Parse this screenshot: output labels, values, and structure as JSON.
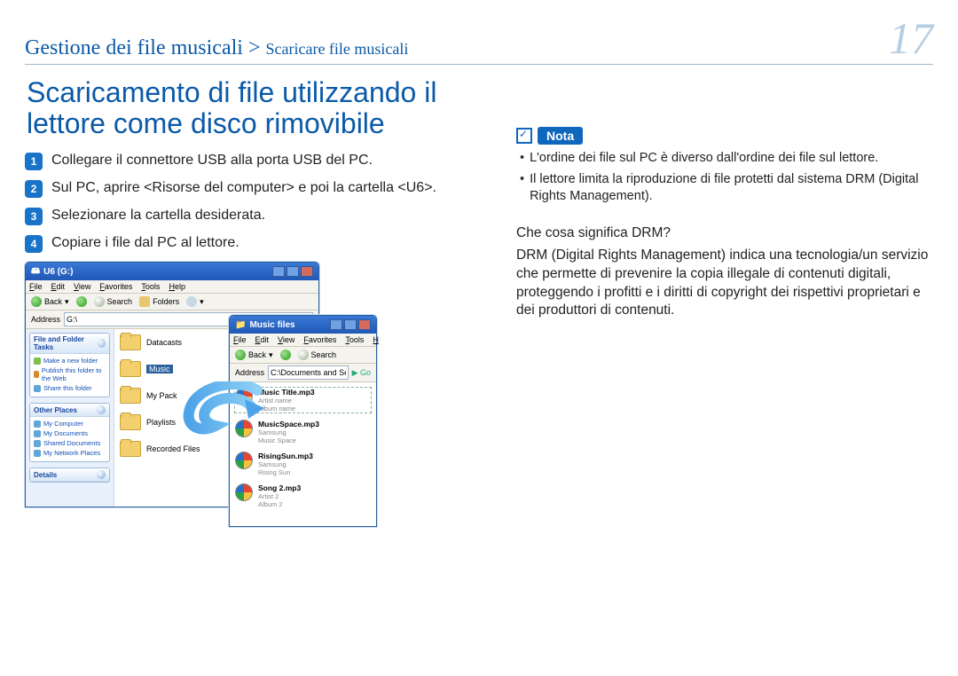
{
  "header": {
    "breadcrumb_main": "Gestione dei file musicali",
    "breadcrumb_separator": " > ",
    "breadcrumb_sub": "Scaricare file musicali",
    "page_number": "17"
  },
  "title": "Scaricamento di file utilizzando il lettore come disco rimovibile",
  "steps": {
    "s1": "Collegare il connettore USB alla porta USB del PC.",
    "s2": "Sul PC, aprire <Risorse del computer> e poi la cartella <U6>.",
    "s3": "Selezionare la cartella desiderata.",
    "s4": "Copiare i file dal PC al lettore."
  },
  "note": {
    "label": "Nota",
    "items": {
      "n1": "L'ordine dei file sul PC è diverso dall'ordine dei file sul lettore.",
      "n2": "Il lettore limita la riproduzione di file protetti dal sistema DRM (Digital Rights Management)."
    }
  },
  "drm": {
    "question": "Che cosa significa DRM?",
    "answer": "DRM (Digital Rights Management) indica una tecnologia/un servizio che permette di prevenire la copia illegale di contenuti digitali, proteggendo i profitti e i diritti di copyright dei rispettivi proprietari e dei produttori di contenuti."
  },
  "explorer1": {
    "title": "U6 (G:)",
    "menu": {
      "m1": "File",
      "m2": "Edit",
      "m3": "View",
      "m4": "Favorites",
      "m5": "Tools",
      "m6": "Help"
    },
    "toolbar": {
      "back": "Back",
      "search": "Search",
      "folders": "Folders"
    },
    "address_label": "Address",
    "address_value": "G:\\",
    "tasks_title": "File and Folder Tasks",
    "tasks": {
      "t1": "Make a new folder",
      "t2": "Publish this folder to the Web",
      "t3": "Share this folder"
    },
    "other_title": "Other Places",
    "other": {
      "o1": "My Computer",
      "o2": "My Documents",
      "o3": "Shared Documents",
      "o4": "My Network Places"
    },
    "details_title": "Details",
    "folders": {
      "f1": "Datacasts",
      "f2": "Music",
      "f3": "My Pack",
      "f4": "Playlists",
      "f5": "Recorded Files"
    }
  },
  "explorer2": {
    "title": "Music files",
    "menu": {
      "m1": "File",
      "m2": "Edit",
      "m3": "View",
      "m4": "Favorites",
      "m5": "Tools",
      "m6": "H"
    },
    "toolbar": {
      "back": "Back",
      "search": "Search"
    },
    "address_label": "Address",
    "address_value": "C:\\Documents and Settings\\",
    "go": "Go",
    "files": [
      {
        "name": "Music Title.mp3",
        "l2": "Artist name",
        "l3": "Album name"
      },
      {
        "name": "MusicSpace.mp3",
        "l2": "Samsung",
        "l3": "Music Space"
      },
      {
        "name": "RisingSun.mp3",
        "l2": "Samsung",
        "l3": "Rising Sun"
      },
      {
        "name": "Song 2.mp3",
        "l2": "Artist 2",
        "l3": "Album 2"
      }
    ]
  }
}
